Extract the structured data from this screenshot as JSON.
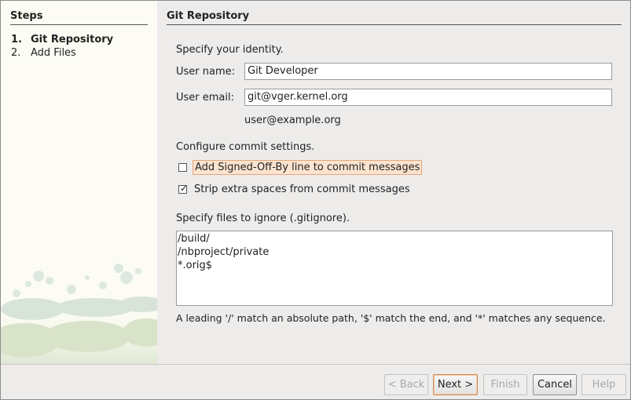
{
  "steps": {
    "title": "Steps",
    "items": [
      {
        "num": "1.",
        "label": "Git Repository"
      },
      {
        "num": "2.",
        "label": "Add Files"
      }
    ]
  },
  "page": {
    "title": "Git Repository",
    "identity_heading": "Specify your identity.",
    "user_name_label": "User name:",
    "user_name_value": "Git Developer",
    "user_email_label": "User email:",
    "user_email_value": "git@vger.kernel.org",
    "email_hint": "user@example.org",
    "commit_heading": "Configure commit settings.",
    "signed_off_label": "Add Signed-Off-By line to commit messages",
    "signed_off_checked": false,
    "strip_spaces_label": "Strip extra spaces from commit messages",
    "strip_spaces_checked": true,
    "ignore_heading": "Specify files to ignore (.gitignore).",
    "ignore_lines": [
      "/build/",
      "/nbproject/private",
      "*.orig$"
    ],
    "ignore_hint": "A leading '/' match an absolute path, '$' match the end, and '*' matches any sequence."
  },
  "buttons": {
    "back": "< Back",
    "next": "Next >",
    "finish": "Finish",
    "cancel": "Cancel",
    "help": "Help"
  },
  "icons": {
    "checkmark": "check-icon"
  }
}
